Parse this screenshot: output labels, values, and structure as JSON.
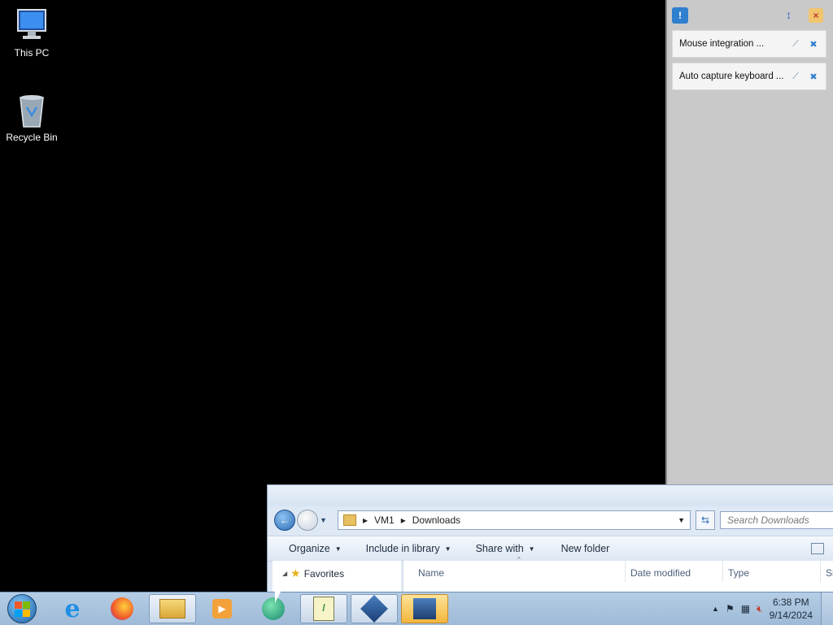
{
  "desktop": {
    "icons": [
      {
        "label": "This PC",
        "icon": "computer-icon"
      },
      {
        "label": "Recycle Bin",
        "icon": "recycle-bin-icon"
      }
    ]
  },
  "vbox_panel": {
    "notifications": [
      {
        "text": "Mouse integration ..."
      },
      {
        "text": "Auto capture keyboard ..."
      }
    ]
  },
  "explorer": {
    "breadcrumb": [
      "VM1",
      "Downloads"
    ],
    "search_placeholder": "Search Downloads",
    "commands": [
      "Organize",
      "Include in library",
      "Share with",
      "New folder"
    ],
    "nav": {
      "favorites": "Favorites"
    },
    "columns": [
      "Name",
      "Date modified",
      "Type",
      "Si"
    ]
  },
  "taskbar": {
    "apps": [
      "start",
      "internet-explorer",
      "firefox",
      "file-explorer",
      "media-player",
      "globe-app",
      "notepad-plus",
      "virtualbox",
      "vm-window"
    ],
    "clock_time": "6:38 PM",
    "clock_date": "9/14/2024"
  },
  "colors": {
    "desktop_bg": "#000000",
    "vbox_panel": "#c9c9c9",
    "taskbar": "#a8c2dd"
  }
}
